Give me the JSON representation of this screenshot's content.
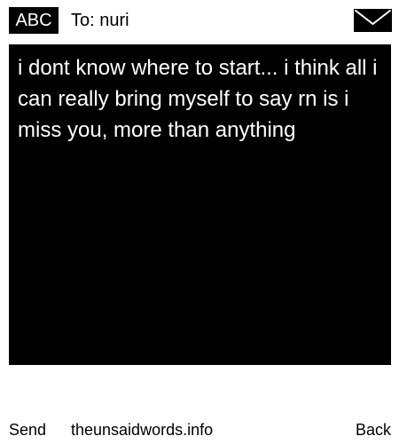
{
  "header": {
    "input_mode": "ABC",
    "recipient": "To: nuri",
    "icon": "envelope-icon"
  },
  "message": {
    "text": "i dont know where to start... i think all i can really bring myself to say rn is i miss you, more than anything"
  },
  "softkeys": {
    "left": "Send",
    "center": "theunsaidwords.info",
    "right": "Back"
  },
  "colors": {
    "background": "#ffffff",
    "message_background": "#000000",
    "message_text": "#ffffff",
    "badge_background": "#000000",
    "badge_text": "#ffffff"
  }
}
